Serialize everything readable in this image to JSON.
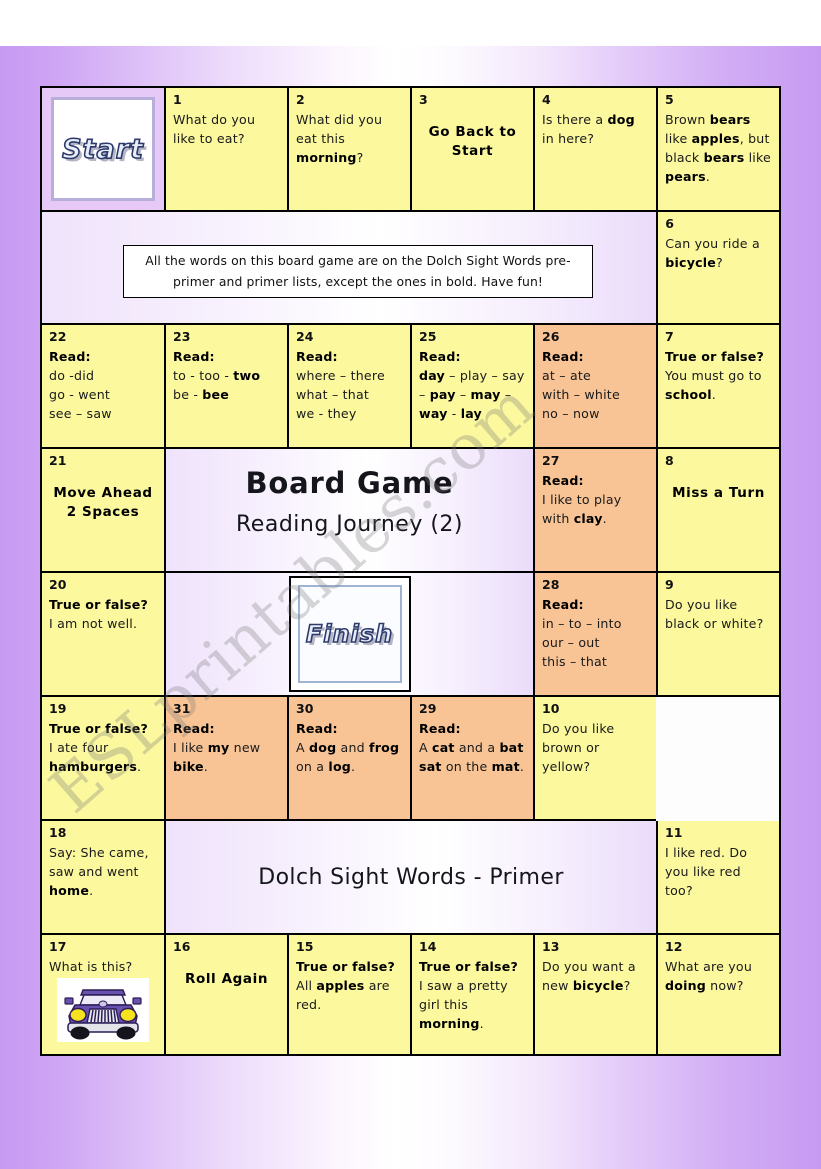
{
  "page": {
    "background_edge_color": "#c79af2",
    "background_center_color": "#ffffff"
  },
  "board": {
    "cell_yellow": "#fbf89e",
    "cell_orange": "#f8c496",
    "start_label": "Start",
    "finish_label": "Finish",
    "notice": "All the words on this board game are on the Dolch Sight Words pre-primer and primer lists, except the ones in bold. Have fun!",
    "title_main": "Board Game",
    "title_sub": "Reading Journey (2)",
    "footer_title": "Dolch Sight Words - Primer"
  },
  "watermark": {
    "diagonal": "ESLprintables.com"
  },
  "cells": {
    "c1": {
      "num": "1",
      "text": "What do you like to eat?"
    },
    "c2": {
      "num": "2",
      "text": "What did you eat this morning?"
    },
    "c3": {
      "num": "3",
      "action": "Go Back to\nStart"
    },
    "c4": {
      "num": "4",
      "text": "Is there a dog in here?"
    },
    "c5": {
      "num": "5",
      "text": "Brown bears like apples, but black bears like pears."
    },
    "c6": {
      "num": "6",
      "text": "Can you ride a bicycle?"
    },
    "c7": {
      "num": "7",
      "lead": "True or false?",
      "text": "You must go to school."
    },
    "c8": {
      "num": "8",
      "action": "Miss a Turn"
    },
    "c9": {
      "num": "9",
      "text": "Do you like black or white?"
    },
    "c10": {
      "num": "10",
      "text": "Do you like brown or yellow?"
    },
    "c11": {
      "num": "11",
      "text": "I like red. Do you like red too?"
    },
    "c12": {
      "num": "12",
      "text": "What are you doing now?"
    },
    "c13": {
      "num": "13",
      "text": "Do you want a new bicycle?"
    },
    "c14": {
      "num": "14",
      "lead": "True or false?",
      "text": "I saw a pretty girl this morning."
    },
    "c15": {
      "num": "15",
      "lead": "True or false?",
      "text": "All apples are red."
    },
    "c16": {
      "num": "16",
      "action": "Roll Again"
    },
    "c17": {
      "num": "17",
      "text": "What is this?",
      "image": "purple-car-clipart"
    },
    "c18": {
      "num": "18",
      "text": "Say: She came, saw and went home."
    },
    "c19": {
      "num": "19",
      "lead": "True or false?",
      "text": "I ate four hamburgers."
    },
    "c20": {
      "num": "20",
      "lead": "True or false?",
      "text": "I am not well."
    },
    "c21": {
      "num": "21",
      "action": "Move Ahead\n2 Spaces"
    },
    "c22": {
      "num": "22",
      "lead": "Read:",
      "text": "do -did\ngo - went\nsee – saw"
    },
    "c23": {
      "num": "23",
      "lead": "Read:",
      "text": "to - too - two\nbe - bee"
    },
    "c24": {
      "num": "24",
      "lead": "Read:",
      "text": "where – there\nwhat – that\nwe - they"
    },
    "c25": {
      "num": "25",
      "lead": "Read:",
      "text": "day – play – say\n– pay – may –\nway - lay"
    },
    "c26": {
      "num": "26",
      "lead": "Read:",
      "text": "at – ate\nwith – white\nno – now"
    },
    "c27": {
      "num": "27",
      "lead": "Read:",
      "text": "I like to play with clay."
    },
    "c28": {
      "num": "28",
      "lead": "Read:",
      "text": "in – to – into\nour – out\nthis – that"
    },
    "c29": {
      "num": "29",
      "lead": "Read:",
      "text": "A cat and a bat sat on the mat."
    },
    "c30": {
      "num": "30",
      "lead": "Read:",
      "text": "A dog and frog on a log."
    },
    "c31": {
      "num": "31",
      "lead": "Read:",
      "text": "I like my new bike."
    }
  }
}
